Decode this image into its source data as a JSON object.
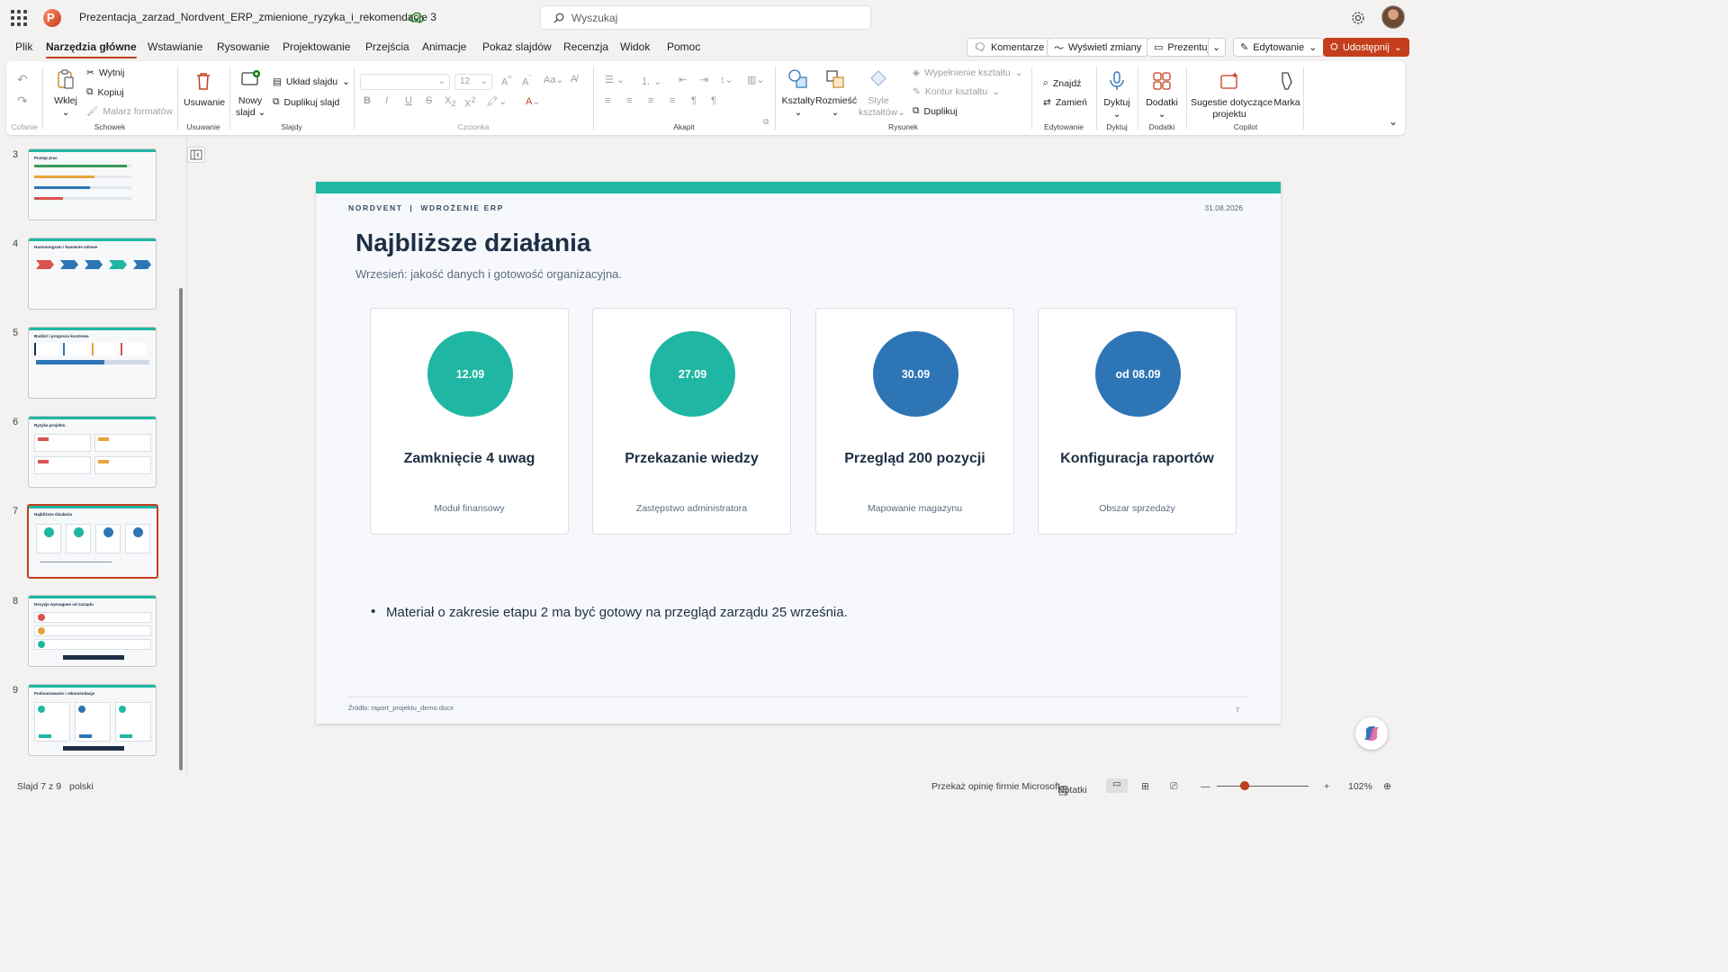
{
  "titlebar": {
    "document_title": "Prezentacja_zarzad_Nordvent_ERP_zmienione_ryzyka_i_rekomendacje 3",
    "search_placeholder": "Wyszukaj"
  },
  "menu": {
    "tabs": [
      "Plik",
      "Narzędzia główne",
      "Wstawianie",
      "Rysowanie",
      "Projektowanie",
      "Przejścia",
      "Animacje",
      "Pokaz slajdów",
      "Recenzja",
      "Widok",
      "Pomoc"
    ],
    "active_tab": "Narzędzia główne",
    "comments": "Komentarze",
    "show_changes": "Wyświetl zmiany",
    "present": "Prezentuj",
    "editing": "Edytowanie",
    "share": "Udostępnij"
  },
  "ribbon": {
    "undo_group": "Cofanie",
    "clipboard": {
      "label": "Schowek",
      "paste": "Wklej",
      "cut": "Wytnij",
      "copy": "Kopiuj",
      "format_painter": "Malarz formatów"
    },
    "delete": {
      "label": "Usuwanie",
      "button": "Usuwanie"
    },
    "slides": {
      "label": "Slajdy",
      "new_slide_1": "Nowy",
      "new_slide_2": "slajd",
      "layout": "Układ slajdu",
      "duplicate": "Duplikuj slajd"
    },
    "font": {
      "label": "Czcionka",
      "font_name": "",
      "font_size": "12"
    },
    "paragraph": {
      "label": "Akapit"
    },
    "drawing": {
      "label": "Rysunek",
      "shapes": "Kształty",
      "arrange": "Rozmieść",
      "styles_1": "Style",
      "styles_2": "kształtów",
      "fill": "Wypełnienie kształtu",
      "outline": "Kontur kształtu",
      "duplicate": "Duplikuj"
    },
    "editing": {
      "label": "Edytowanie",
      "find": "Znajdź",
      "replace": "Zamień"
    },
    "dictate": {
      "label": "Dyktuj",
      "button": "Dyktuj"
    },
    "addins": {
      "label": "Dodatki",
      "button": "Dodatki"
    },
    "copilot": {
      "label": "Copilot",
      "suggestions_1": "Sugestie dotyczące",
      "suggestions_2": "projektu",
      "brand": "Marka"
    }
  },
  "thumbnails": [
    {
      "num": "3",
      "title": "Postęp prac",
      "selected": false
    },
    {
      "num": "4",
      "title": "Harmonogram i kamienie milowe",
      "selected": false
    },
    {
      "num": "5",
      "title": "Budżet i prognoza kosztowa",
      "selected": false
    },
    {
      "num": "6",
      "title": "Ryzyka projektu",
      "selected": false
    },
    {
      "num": "7",
      "title": "Najbliższe działania",
      "selected": true
    },
    {
      "num": "8",
      "title": "Decyzje wymagane od zarządu",
      "selected": false
    },
    {
      "num": "9",
      "title": "Podsumowanie i rekomendacje",
      "selected": false
    }
  ],
  "slide": {
    "kicker": "NORDVENT  |  WDROŻENIE ERP",
    "date": "31.08.2026",
    "title": "Najbliższe działania",
    "subtitle": "Wrzesień: jakość danych i gotowość organizacyjna.",
    "cards": [
      {
        "date": "12.09",
        "title": "Zamknięcie 4 uwag",
        "subtitle": "Moduł finansowy",
        "color": "#1fb7a3"
      },
      {
        "date": "27.09",
        "title": "Przekazanie wiedzy",
        "subtitle": "Zastępstwo administratora",
        "color": "#1fb7a3"
      },
      {
        "date": "30.09",
        "title": "Przegląd 200 pozycji",
        "subtitle": "Mapowanie magazynu",
        "color": "#2e75b6"
      },
      {
        "date": "od 08.09",
        "title": "Konfiguracja raportów",
        "subtitle": "Obszar sprzedaży",
        "color": "#2e75b6"
      }
    ],
    "bullet": "Materiał o zakresie etapu 2 ma być gotowy na przegląd zarządu 25 września.",
    "source": "Źródło: raport_projektu_demo.docx",
    "page_number": "7"
  },
  "statusbar": {
    "slide_info": "Slajd 7 z 9",
    "language": "polski",
    "feedback": "Przekaż opinię firmie Microsoft",
    "notes": "Notatki",
    "zoom": "102%",
    "zoom_level_percent": 102
  },
  "colors": {
    "accent": "#c43e1c",
    "teal": "#1fb7a3",
    "blue": "#2e75b6",
    "navy": "#1d2f45"
  }
}
